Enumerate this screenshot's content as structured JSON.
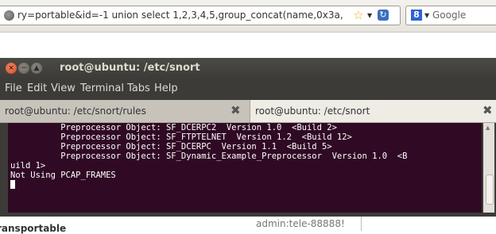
{
  "browser": {
    "url": "ry=portable&id=-1 union select 1,2,3,4,5,group_concat(name,0x3a,",
    "search_engine": "Google",
    "star_glyph": "☆",
    "dropdown_glyph": "▼"
  },
  "terminal": {
    "title": "root@ubuntu: /etc/snort",
    "menu": [
      "File",
      "Edit",
      "View",
      "Terminal",
      "Tabs",
      "Help"
    ],
    "tabs": [
      {
        "label": "root@ubuntu: /etc/snort/rules",
        "active": false
      },
      {
        "label": "root@ubuntu: /etc/snort",
        "active": true
      }
    ],
    "lines": [
      "          Preprocessor Object: SF_DCERPC2  Version 1.0  <Build 2>",
      "          Preprocessor Object: SF_FTPTELNET  Version 1.2  <Build 12>",
      "          Preprocessor Object: SF_DCERPC  Version 1.1  <Build 5>",
      "          Preprocessor Object: SF_Dynamic_Example_Preprocessor  Version 1.0  <B",
      "uild 1>",
      "Not Using PCAP_FRAMES"
    ],
    "colors": {
      "background": "#300a24",
      "foreground": "#ffffff",
      "chrome": "#3c3b37"
    }
  },
  "page": {
    "partial_left_text": "ransportable",
    "center_text": "admin:tele-88888!"
  }
}
